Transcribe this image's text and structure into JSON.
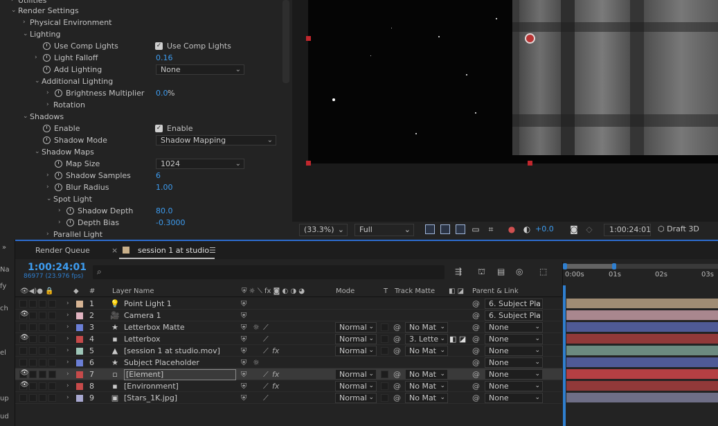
{
  "effect_controls": {
    "top_partial": "Utilities",
    "render_settings": "Render Settings",
    "physical_environment": "Physical Environment",
    "lighting": "Lighting",
    "use_comp_lights_label": "Use Comp Lights",
    "use_comp_lights_value": "Use Comp Lights",
    "light_falloff_label": "Light Falloff",
    "light_falloff_value": "0.16",
    "add_lighting_label": "Add Lighting",
    "add_lighting_value": "None",
    "additional_lighting": "Additional Lighting",
    "brightness_multiplier_label": "Brightness Multiplier",
    "brightness_multiplier_value": "0.0",
    "brightness_multiplier_unit": "%",
    "rotation_label": "Rotation",
    "shadows": "Shadows",
    "enable_label": "Enable",
    "enable_value": "Enable",
    "shadow_mode_label": "Shadow Mode",
    "shadow_mode_value": "Shadow Mapping",
    "shadow_maps": "Shadow Maps",
    "map_size_label": "Map Size",
    "map_size_value": "1024",
    "shadow_samples_label": "Shadow Samples",
    "shadow_samples_value": "6",
    "blur_radius_label": "Blur Radius",
    "blur_radius_value": "1.00",
    "spot_light": "Spot Light",
    "shadow_depth_label": "Shadow Depth",
    "shadow_depth_value": "80.0",
    "depth_bias_label": "Depth Bias",
    "depth_bias_value": "-0.3000",
    "parallel_light": "Parallel Light"
  },
  "viewer_bar": {
    "zoom": "(33.3%)",
    "resolution": "Full",
    "exposure": "+0.0",
    "timecode": "1:00:24:01",
    "renderer": "Draft 3D"
  },
  "timeline": {
    "tab_render_queue": "Render Queue",
    "tab_comp": "session 1 at studio",
    "tab_menu": "☰",
    "current_time": "1:00:24:01",
    "frame_info": "86977 (23.976 fps)",
    "search_icon": "⌕",
    "col_hash": "#",
    "col_layer_name": "Layer Name",
    "col_mode": "Mode",
    "col_t": "T",
    "col_track_matte": "Track Matte",
    "col_parent": "Parent & Link",
    "ruler": [
      "0:00s",
      "01s",
      "02s",
      "03s"
    ],
    "edge_labels": [
      "Na",
      "fy",
      "ch",
      "el",
      "up",
      "ud"
    ],
    "layers": [
      {
        "num": "1",
        "name": "Point Light 1",
        "label_color": "#d6b494",
        "icon": "💡",
        "parent": "6. Subject Pla",
        "bar_color": "#a08c74",
        "eye": false
      },
      {
        "num": "2",
        "name": "Camera 1",
        "label_color": "#e0b3c0",
        "icon": "🎥",
        "parent": "6. Subject Pla",
        "bar_color": "#a9878e",
        "eye": true
      },
      {
        "num": "3",
        "name": "Letterbox Matte",
        "label_color": "#6b7fd6",
        "icon": "★",
        "mode": "Normal",
        "matte": "No Mat",
        "parent": "None",
        "bar_color": "#4f5a96",
        "eye": false
      },
      {
        "num": "4",
        "name": "Letterbox",
        "label_color": "#c64a4a",
        "icon": "▪",
        "mode": "Normal",
        "matte": "3. Lette",
        "parent": "None",
        "bar_color": "#913939",
        "eye": true
      },
      {
        "num": "5",
        "name": "[session 1 at studio.mov]",
        "label_color": "#9ec6b8",
        "icon": "▲",
        "mode": "Normal",
        "matte": "No Mat",
        "parent": "None",
        "bar_color": "#6c8a80",
        "eye": false
      },
      {
        "num": "6",
        "name": "Subject Placeholder",
        "label_color": "#6b7fd6",
        "icon": "★",
        "parent": "None",
        "bar_color": "#4f5a96",
        "eye": false
      },
      {
        "num": "7",
        "name": "[Element]",
        "label_color": "#c64a4a",
        "icon": "▫",
        "mode": "Normal",
        "matte": "No Mat",
        "parent": "None",
        "bar_color": "#b53f43",
        "eye": true
      },
      {
        "num": "8",
        "name": "[Environment]",
        "label_color": "#c64a4a",
        "icon": "▪",
        "mode": "Normal",
        "matte": "No Mat",
        "parent": "None",
        "bar_color": "#913939",
        "eye": true
      },
      {
        "num": "9",
        "name": "[Stars_1K.jpg]",
        "label_color": "#a8a8d0",
        "icon": "▣",
        "mode": "Normal",
        "matte": "No Mat",
        "parent": "None",
        "bar_color": "#6e6e86",
        "eye": false
      }
    ]
  }
}
